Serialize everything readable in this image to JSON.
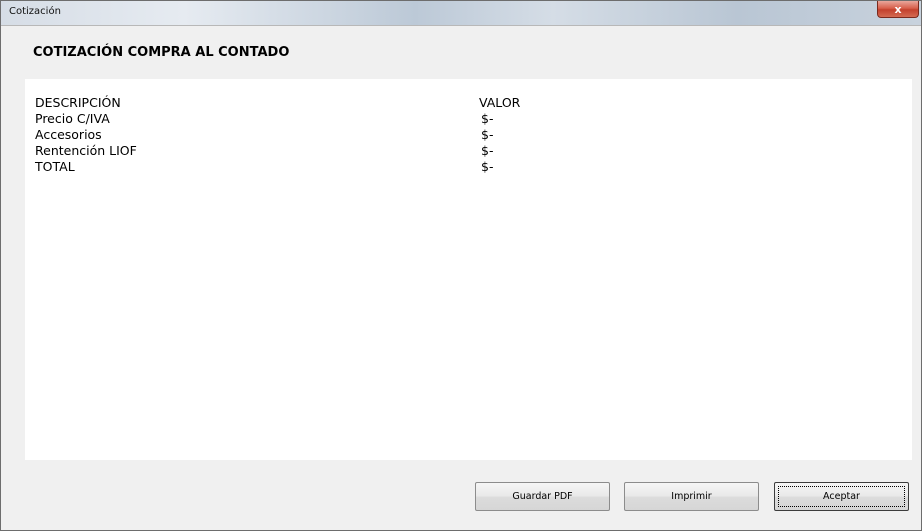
{
  "window": {
    "title": "Cotización",
    "close_glyph": "x",
    "close_icon": "close-icon"
  },
  "heading": "COTIZACIÓN COMPRA AL CONTADO",
  "table": {
    "header": {
      "description": "DESCRIPCIÓN",
      "value": "VALOR"
    },
    "rows": [
      {
        "description": "Precio C/IVA",
        "value": "$-"
      },
      {
        "description": "Accesorios",
        "value": "$-"
      },
      {
        "description": "Rentención LIOF",
        "value": "$-"
      },
      {
        "description": "TOTAL",
        "value": "$-"
      }
    ]
  },
  "buttons": {
    "save_pdf": "Guardar PDF",
    "print": "Imprimir",
    "accept": "Aceptar"
  }
}
